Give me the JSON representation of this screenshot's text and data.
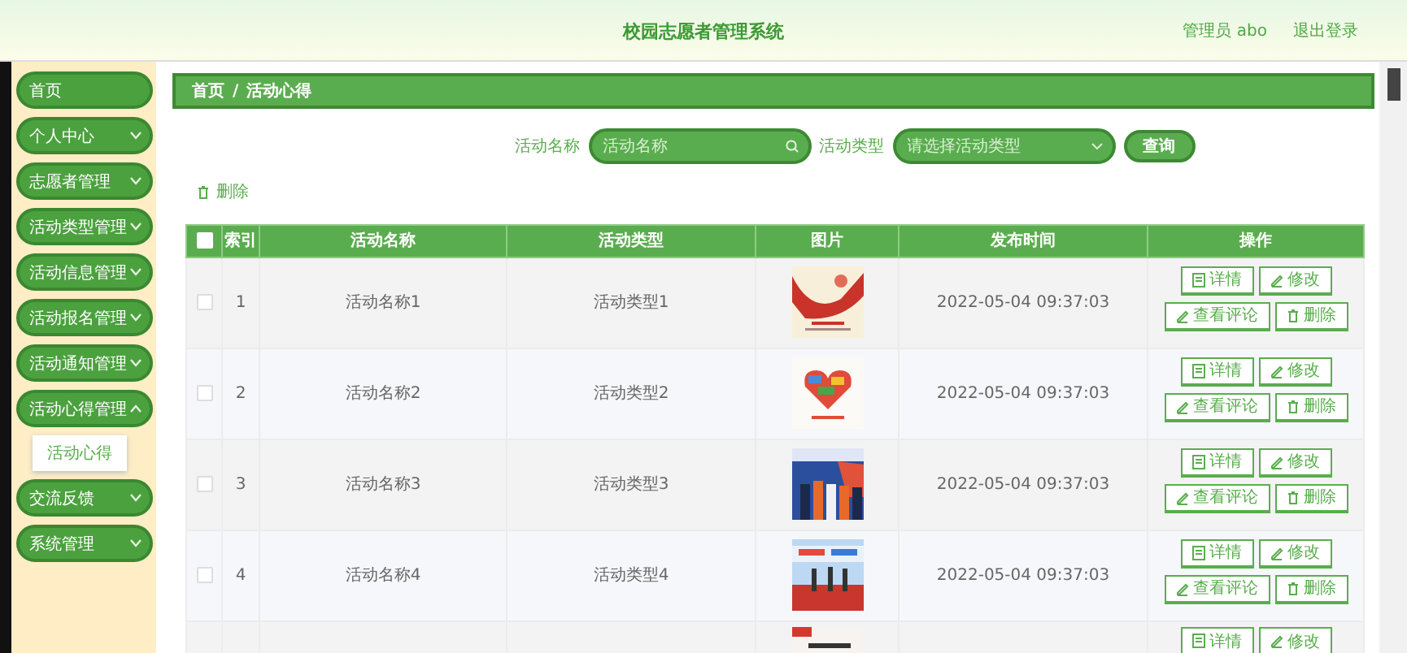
{
  "header": {
    "title": "校园志愿者管理系统",
    "user": "管理员 abo",
    "logout": "退出登录"
  },
  "sidebar": {
    "items": [
      {
        "kind": "link",
        "label": "首页"
      },
      {
        "kind": "group",
        "label": "个人中心",
        "expanded": false
      },
      {
        "kind": "group",
        "label": "志愿者管理",
        "expanded": false
      },
      {
        "kind": "group",
        "label": "活动类型管理",
        "expanded": false
      },
      {
        "kind": "group",
        "label": "活动信息管理",
        "expanded": false
      },
      {
        "kind": "group",
        "label": "活动报名管理",
        "expanded": false
      },
      {
        "kind": "group",
        "label": "活动通知管理",
        "expanded": false
      },
      {
        "kind": "group",
        "label": "活动心得管理",
        "expanded": true,
        "children": [
          {
            "label": "活动心得"
          }
        ]
      },
      {
        "kind": "group",
        "label": "交流反馈",
        "expanded": false
      },
      {
        "kind": "group",
        "label": "系统管理",
        "expanded": false
      }
    ]
  },
  "breadcrumb": [
    "首页",
    "活动心得"
  ],
  "breadcrumb_separator": "/",
  "search": {
    "fields": [
      {
        "kind": "text",
        "label": "活动名称",
        "placeholder": "活动名称"
      },
      {
        "kind": "select",
        "label": "活动类型",
        "placeholder": "请选择活动类型"
      }
    ],
    "button": "查询"
  },
  "delete_button": "删除",
  "table": {
    "header_checked": false,
    "columns": [
      "索引",
      "活动名称",
      "活动类型",
      "图片",
      "发布时间",
      "操作"
    ],
    "rows": [
      {
        "checked": false,
        "index": "1",
        "name": "活动名称1",
        "type": "活动类型1",
        "time": "2022-05-04 09:37:03",
        "actions": [
          {
            "kind": "detail",
            "label": "详情"
          },
          {
            "kind": "edit",
            "label": "修改"
          },
          {
            "kind": "edit",
            "label": "查看评论"
          },
          {
            "kind": "delete",
            "label": "删除"
          }
        ]
      },
      {
        "checked": false,
        "index": "2",
        "name": "活动名称2",
        "type": "活动类型2",
        "time": "2022-05-04 09:37:03",
        "actions": [
          {
            "kind": "detail",
            "label": "详情"
          },
          {
            "kind": "edit",
            "label": "修改"
          },
          {
            "kind": "edit",
            "label": "查看评论"
          },
          {
            "kind": "delete",
            "label": "删除"
          }
        ]
      },
      {
        "checked": false,
        "index": "3",
        "name": "活动名称3",
        "type": "活动类型3",
        "time": "2022-05-04 09:37:03",
        "actions": [
          {
            "kind": "detail",
            "label": "详情"
          },
          {
            "kind": "edit",
            "label": "修改"
          },
          {
            "kind": "edit",
            "label": "查看评论"
          },
          {
            "kind": "delete",
            "label": "删除"
          }
        ]
      },
      {
        "checked": false,
        "index": "4",
        "name": "活动名称4",
        "type": "活动类型4",
        "time": "2022-05-04 09:37:03",
        "actions": [
          {
            "kind": "detail",
            "label": "详情"
          },
          {
            "kind": "edit",
            "label": "修改"
          },
          {
            "kind": "edit",
            "label": "查看评论"
          },
          {
            "kind": "delete",
            "label": "删除"
          }
        ]
      },
      {
        "actions": [
          {
            "kind": "detail",
            "label": "详情"
          },
          {
            "kind": "edit",
            "label": "修改"
          }
        ]
      }
    ]
  }
}
